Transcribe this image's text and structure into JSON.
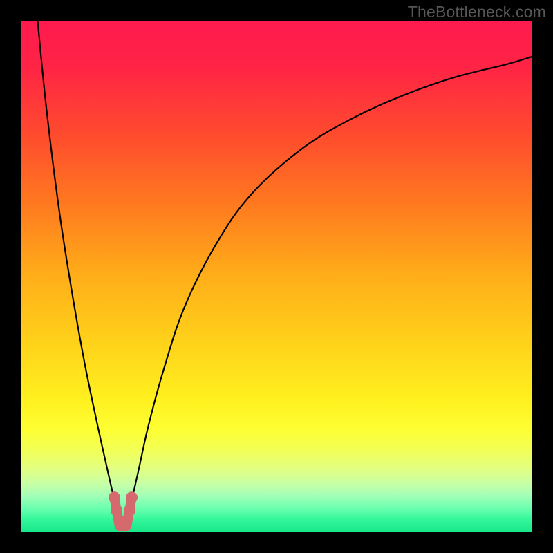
{
  "watermark": "TheBottleneck.com",
  "colors": {
    "frame": "#000000",
    "gradient_stops": [
      {
        "offset": 0.0,
        "color": "#ff1a4f"
      },
      {
        "offset": 0.09,
        "color": "#ff2445"
      },
      {
        "offset": 0.22,
        "color": "#ff4a2e"
      },
      {
        "offset": 0.36,
        "color": "#ff7a1f"
      },
      {
        "offset": 0.5,
        "color": "#ffae19"
      },
      {
        "offset": 0.63,
        "color": "#ffd21a"
      },
      {
        "offset": 0.74,
        "color": "#fff01f"
      },
      {
        "offset": 0.8,
        "color": "#fdff33"
      },
      {
        "offset": 0.84,
        "color": "#f2ff56"
      },
      {
        "offset": 0.875,
        "color": "#e2ff80"
      },
      {
        "offset": 0.905,
        "color": "#c8ffa6"
      },
      {
        "offset": 0.93,
        "color": "#a0ffb8"
      },
      {
        "offset": 0.955,
        "color": "#66ffae"
      },
      {
        "offset": 0.975,
        "color": "#33f79a"
      },
      {
        "offset": 1.0,
        "color": "#18e68a"
      }
    ],
    "curve": "#000000",
    "marker_fill": "#d46a6e",
    "marker_stroke": "#d46a6e"
  },
  "chart_data": {
    "type": "line",
    "title": "",
    "xlabel": "",
    "ylabel": "",
    "xlim": [
      0,
      100
    ],
    "ylim": [
      0,
      100
    ],
    "grid": false,
    "legend": false,
    "description": "Bottleneck curve: y ≈ |log(x / x_min)| style V-curve with minimum near x≈20 and asymptotes toward x→0 and x→∞.",
    "series": [
      {
        "name": "bottleneck-curve",
        "x": [
          3.3,
          5,
          7.5,
          10,
          12.5,
          15,
          17,
          18.5,
          19.5,
          20.5,
          21.5,
          23,
          25,
          28,
          32,
          38,
          45,
          55,
          65,
          75,
          85,
          95,
          100
        ],
        "y": [
          100,
          83,
          63,
          47,
          33,
          21,
          12,
          5.5,
          2,
          2,
          5.5,
          12,
          21,
          32,
          44,
          56,
          66,
          75,
          81,
          85.5,
          89,
          91.5,
          93
        ]
      }
    ],
    "marker_points": {
      "name": "optimal-range-markers",
      "x": [
        18.3,
        18.7,
        19.3,
        19.7,
        20.3,
        20.7,
        21.3,
        21.7
      ],
      "y": [
        6.8,
        4.3,
        2.3,
        1.7,
        1.7,
        2.3,
        4.3,
        6.8
      ]
    },
    "marker_path_bottom_y": 1.2
  }
}
